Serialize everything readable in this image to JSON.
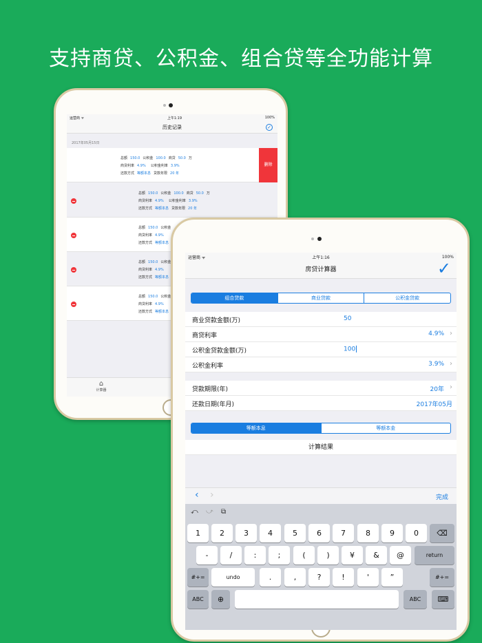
{
  "headline": "支持商贷、公积金、组合贷等全功能计算",
  "history": {
    "status": {
      "carrier": "运营商 ᯤ",
      "time": "上午1:19",
      "battery": "100%"
    },
    "title": "历史记录",
    "date_header": "2017年05月15日",
    "labels": {
      "total": "总额",
      "commercial": "商贷",
      "fund": "公积金",
      "unit": "万",
      "comm_rate": "商贷利率",
      "fund_rate": "公积金利率",
      "method": "还款方式",
      "years": "贷款年限"
    },
    "record": {
      "total": "150.0",
      "fund": "100.0",
      "commercial": "50.0",
      "comm_rate": "4.9%",
      "fund_rate": "3.9%",
      "method": "等额本息",
      "years": "20 年"
    },
    "delete_label": "删除",
    "tab_calc": "计算器"
  },
  "calc": {
    "status": {
      "carrier": "运营商 ᯤ",
      "time": "上午1:16",
      "battery": "100%"
    },
    "title": "房贷计算器",
    "confirm_icon": "✓",
    "loan_tabs": [
      "组合贷款",
      "商业贷款",
      "公积金贷款"
    ],
    "rows": {
      "comm_amount_label": "商业贷款金额(万)",
      "comm_amount": "50",
      "comm_rate_label": "商贷利率",
      "comm_rate": "4.9%",
      "fund_amount_label": "公积金贷款金额(万)",
      "fund_amount": "100",
      "fund_rate_label": "公积金利率",
      "fund_rate": "3.9%",
      "years_label": "贷款期限(年)",
      "years": "20年",
      "date_label": "还款日期(年月)",
      "date": "2017年05月"
    },
    "method_tabs": [
      "等额本息",
      "等额本金"
    ],
    "result_label": "计算结果",
    "done_label": "完成",
    "keys_row1": [
      "1",
      "2",
      "3",
      "4",
      "5",
      "6",
      "7",
      "8",
      "9",
      "0"
    ],
    "keys_row2": [
      "-",
      "/",
      ":",
      ";",
      "(",
      ")",
      "¥",
      "&",
      "@"
    ],
    "keys_row3": [
      "undo",
      ".",
      ",",
      "?",
      "!",
      "'",
      "”"
    ],
    "key_switch": "#+=",
    "key_return": "return",
    "key_abc": "ABC"
  },
  "colors": {
    "background": "#1aab5a",
    "accent": "#1a7de0",
    "delete": "#f0353a"
  }
}
